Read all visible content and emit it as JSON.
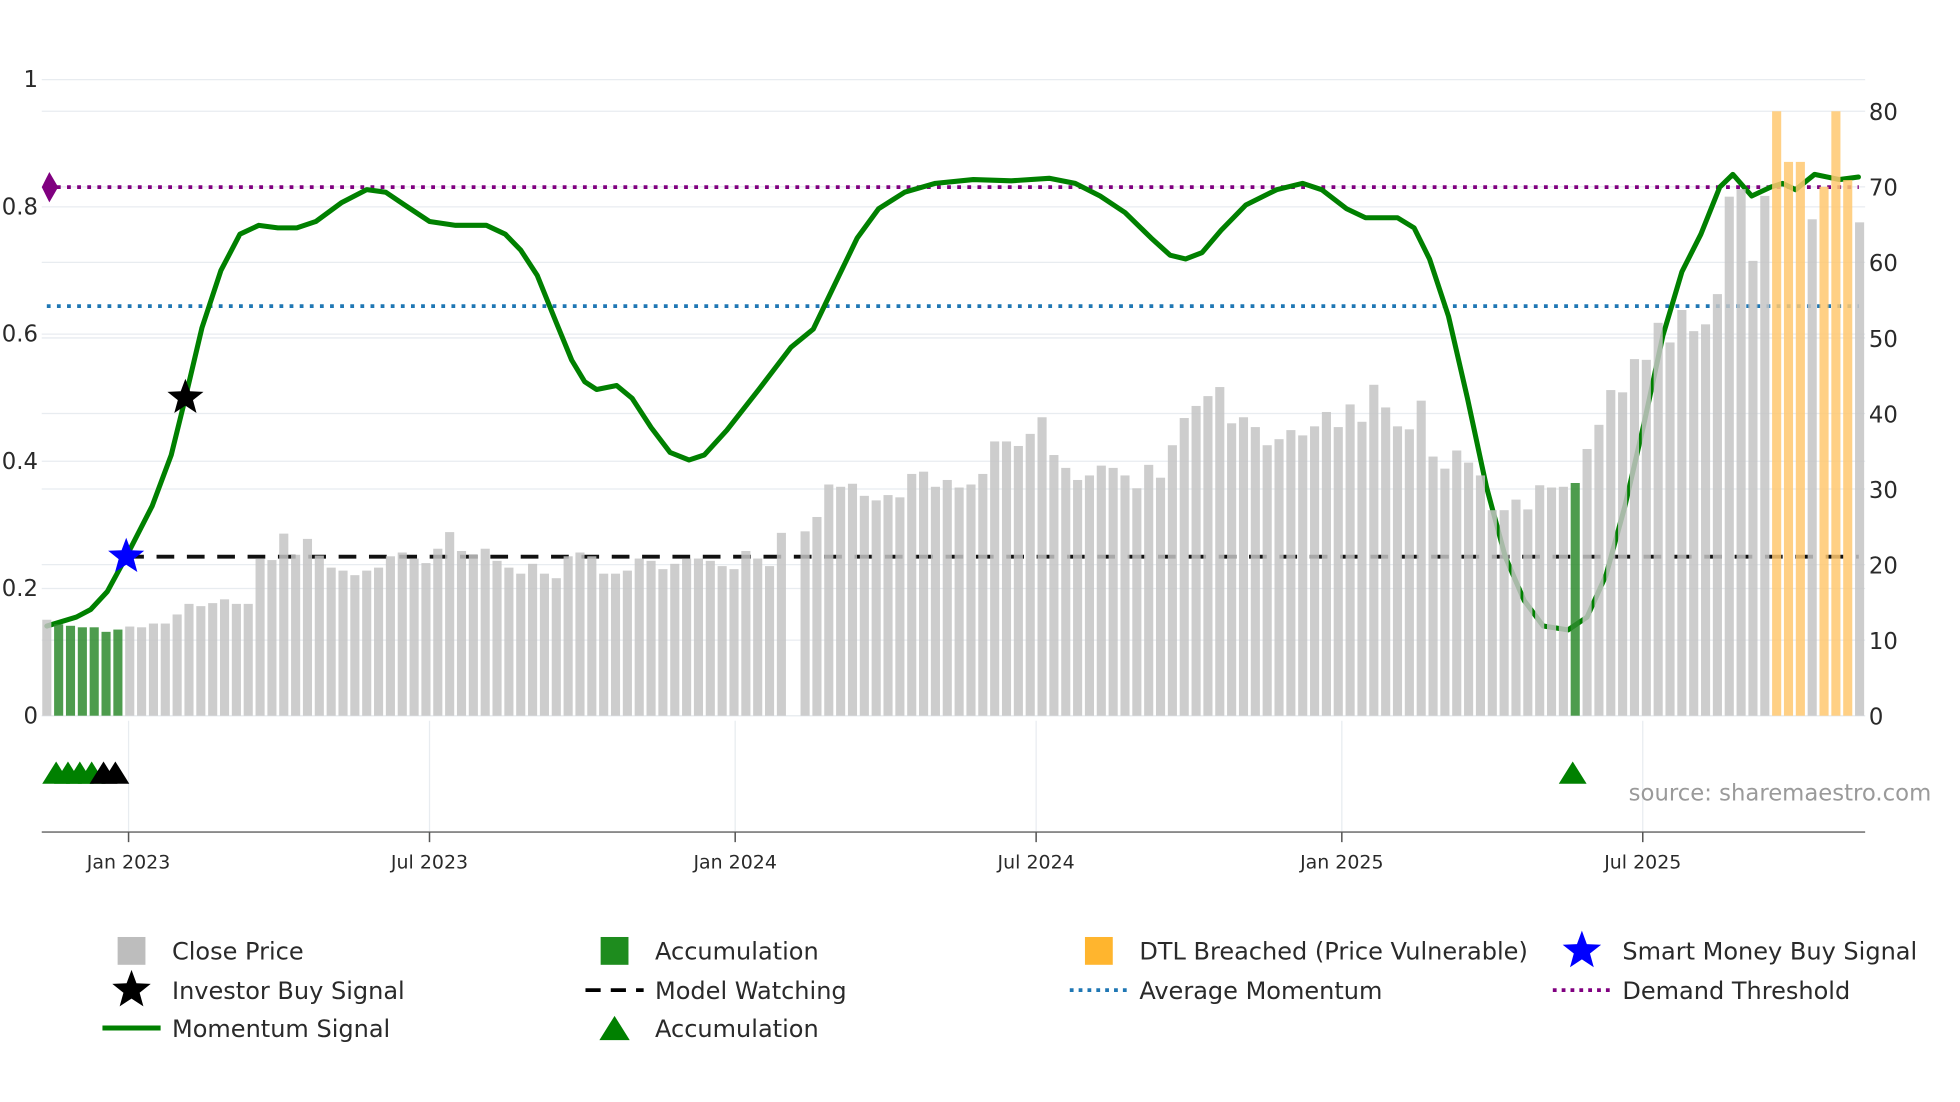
{
  "chart_data": {
    "type": "bar+line",
    "title": "",
    "left_axis": {
      "ticks": [
        "0",
        "0.2",
        "0.4",
        "0.6",
        "0.8",
        "1"
      ],
      "tick_values": [
        0,
        0.2,
        0.4,
        0.6,
        0.8,
        1
      ],
      "range": [
        0,
        1
      ]
    },
    "right_axis": {
      "ticks": [
        "0",
        "10",
        "20",
        "30",
        "40",
        "50",
        "60",
        "70",
        "80"
      ],
      "tick_values": [
        0,
        10,
        20,
        30,
        40,
        50,
        60,
        70,
        80
      ],
      "range": [
        0,
        80
      ]
    },
    "x_axis": {
      "tick_labels": [
        "Jan 2023",
        "Jul 2023",
        "Jan 2024",
        "Jul 2024",
        "Jan 2025",
        "Jul 2025"
      ],
      "tick_weeks": [
        6.9,
        32.3,
        58.1,
        83.5,
        109.3,
        134.7
      ],
      "unit": "weekly bars, index from first week shown"
    },
    "grid": true,
    "close_price": {
      "values": [
        12.7,
        12.1,
        11.9,
        11.7,
        11.7,
        11.1,
        11.4,
        11.8,
        11.7,
        12.2,
        12.2,
        13.4,
        14.8,
        14.5,
        14.9,
        15.4,
        14.8,
        14.8,
        20.8,
        20.6,
        24.1,
        21.3,
        23.4,
        21.2,
        19.6,
        19.2,
        18.6,
        19.2,
        19.6,
        21.1,
        21.6,
        20.8,
        20.2,
        22.1,
        24.3,
        21.8,
        21.3,
        22.1,
        20.5,
        19.6,
        18.8,
        20.1,
        18.8,
        18.2,
        21.1,
        21.6,
        21.1,
        18.8,
        18.8,
        19.2,
        20.8,
        20.5,
        19.4,
        20.1,
        20.8,
        20.8,
        20.5,
        19.8,
        19.4,
        21.8,
        20.8,
        19.8,
        24.2,
        null,
        24.4,
        26.3,
        30.6,
        30.3,
        30.7,
        29.1,
        28.5,
        29.2,
        28.9,
        32.0,
        32.3,
        30.3,
        31.2,
        30.2,
        30.6,
        32.0,
        36.3,
        36.3,
        35.7,
        37.3,
        39.5,
        34.5,
        32.8,
        31.2,
        31.8,
        33.1,
        32.8,
        31.8,
        30.1,
        33.2,
        31.5,
        35.8,
        39.4,
        41.0,
        42.3,
        43.5,
        38.7,
        39.5,
        38.2,
        35.8,
        36.6,
        37.8,
        37.1,
        38.3,
        40.2,
        38.2,
        41.2,
        38.9,
        43.8,
        40.8,
        38.3,
        37.9,
        41.7,
        34.3,
        32.7,
        35.1,
        33.5,
        31.8,
        27.2,
        27.2,
        28.6,
        27.3,
        30.5,
        30.2,
        30.3,
        30.8,
        35.3,
        38.5,
        43.1,
        42.8,
        47.2,
        47.1,
        52.0,
        49.4,
        53.7,
        50.9,
        51.8,
        55.8,
        68.7,
        69.7,
        60.2,
        68.8,
        80,
        73.3,
        73.3,
        65.7,
        70,
        80,
        70.9,
        65.3
      ],
      "accumulation_weeks": [
        1,
        2,
        3,
        4,
        5,
        6,
        129
      ],
      "dtl_breached_weeks": [
        146,
        147,
        148,
        150,
        151,
        152
      ]
    },
    "momentum": [
      [
        0,
        0.141
      ],
      [
        2.5,
        0.155
      ],
      [
        3.7,
        0.167
      ],
      [
        5.1,
        0.195
      ],
      [
        6.7,
        0.25
      ],
      [
        8.9,
        0.33
      ],
      [
        10.5,
        0.41
      ],
      [
        11.7,
        0.5
      ],
      [
        13.1,
        0.61
      ],
      [
        14.7,
        0.7
      ],
      [
        16.3,
        0.757
      ],
      [
        17.9,
        0.771
      ],
      [
        19.5,
        0.767
      ],
      [
        21.1,
        0.767
      ],
      [
        22.7,
        0.777
      ],
      [
        24.9,
        0.807
      ],
      [
        27.0,
        0.827
      ],
      [
        28.6,
        0.823
      ],
      [
        30.2,
        0.803
      ],
      [
        32.3,
        0.777
      ],
      [
        34.5,
        0.771
      ],
      [
        37.1,
        0.771
      ],
      [
        38.7,
        0.757
      ],
      [
        40.0,
        0.732
      ],
      [
        41.4,
        0.692
      ],
      [
        43.0,
        0.618
      ],
      [
        44.3,
        0.559
      ],
      [
        45.4,
        0.525
      ],
      [
        46.4,
        0.513
      ],
      [
        48.1,
        0.519
      ],
      [
        49.4,
        0.499
      ],
      [
        51.0,
        0.453
      ],
      [
        52.6,
        0.414
      ],
      [
        54.2,
        0.402
      ],
      [
        55.5,
        0.41
      ],
      [
        57.4,
        0.449
      ],
      [
        60.1,
        0.513
      ],
      [
        62.8,
        0.579
      ],
      [
        64.7,
        0.608
      ],
      [
        66.5,
        0.678
      ],
      [
        68.4,
        0.751
      ],
      [
        70.2,
        0.797
      ],
      [
        72.4,
        0.823
      ],
      [
        75.0,
        0.837
      ],
      [
        78.2,
        0.843
      ],
      [
        81.4,
        0.841
      ],
      [
        84.6,
        0.845
      ],
      [
        86.8,
        0.837
      ],
      [
        88.9,
        0.817
      ],
      [
        91.0,
        0.791
      ],
      [
        93.2,
        0.751
      ],
      [
        94.8,
        0.724
      ],
      [
        96.1,
        0.718
      ],
      [
        97.5,
        0.728
      ],
      [
        99.1,
        0.763
      ],
      [
        101.2,
        0.803
      ],
      [
        103.8,
        0.827
      ],
      [
        106.0,
        0.837
      ],
      [
        107.6,
        0.827
      ],
      [
        109.7,
        0.797
      ],
      [
        111.3,
        0.783
      ],
      [
        114.0,
        0.783
      ],
      [
        115.4,
        0.767
      ],
      [
        116.7,
        0.718
      ],
      [
        118.3,
        0.628
      ],
      [
        119.9,
        0.499
      ],
      [
        121.5,
        0.36
      ],
      [
        123.1,
        0.25
      ],
      [
        124.7,
        0.181
      ],
      [
        126.3,
        0.141
      ],
      [
        128.4,
        0.135
      ],
      [
        130.0,
        0.155
      ],
      [
        131.6,
        0.221
      ],
      [
        133.2,
        0.33
      ],
      [
        134.8,
        0.459
      ],
      [
        136.4,
        0.598
      ],
      [
        138.0,
        0.698
      ],
      [
        139.6,
        0.757
      ],
      [
        141.2,
        0.831
      ],
      [
        142.3,
        0.851
      ],
      [
        143.9,
        0.817
      ],
      [
        145.5,
        0.831
      ],
      [
        146.5,
        0.837
      ],
      [
        147.6,
        0.827
      ],
      [
        149.2,
        0.851
      ],
      [
        151.3,
        0.843
      ],
      [
        152.9,
        0.847
      ]
    ],
    "model_watching": {
      "value": 0.25,
      "start_week": 6.7
    },
    "average_momentum": 0.644,
    "demand_threshold": 0.831,
    "smart_money_buy_signal": {
      "week": 6.7,
      "value": 0.25
    },
    "investor_buy_signal": {
      "week": 11.7,
      "value": 0.5
    },
    "accumulation_markers": [
      1,
      2,
      3,
      4,
      129
    ],
    "investor_markers": [
      5,
      6
    ],
    "annotation": "source: sharemaestro.com",
    "legend": [
      {
        "label": "Close Price",
        "symbol": "square",
        "color": "#bdbdbd"
      },
      {
        "label": "Accumulation",
        "symbol": "square",
        "color": "#1e8c1e"
      },
      {
        "label": "DTL Breached (Price Vulnerable)",
        "symbol": "square",
        "color": "#ffb52e"
      },
      {
        "label": "Smart Money Buy Signal",
        "symbol": "star",
        "color": "#0000ff"
      },
      {
        "label": "Investor Buy Signal",
        "symbol": "star",
        "color": "#000000"
      },
      {
        "label": "Model Watching",
        "symbol": "dash",
        "color": "#000000"
      },
      {
        "label": "Average Momentum",
        "symbol": "dot",
        "color": "#1f77b4"
      },
      {
        "label": "Demand Threshold",
        "symbol": "dot",
        "color": "#800080"
      },
      {
        "label": "Momentum Signal",
        "symbol": "line",
        "color": "#008000"
      },
      {
        "label": "Accumulation",
        "symbol": "triangle",
        "color": "#008000"
      }
    ],
    "legend_placement": "bottom",
    "colors": {
      "close": "#c4c4c4",
      "accum": "#2e8b2e",
      "dtl": "#ffc870",
      "momentum": "#008000",
      "avg": "#1f77b4",
      "threshold": "#800080",
      "grid": "#e8ecf0"
    }
  }
}
